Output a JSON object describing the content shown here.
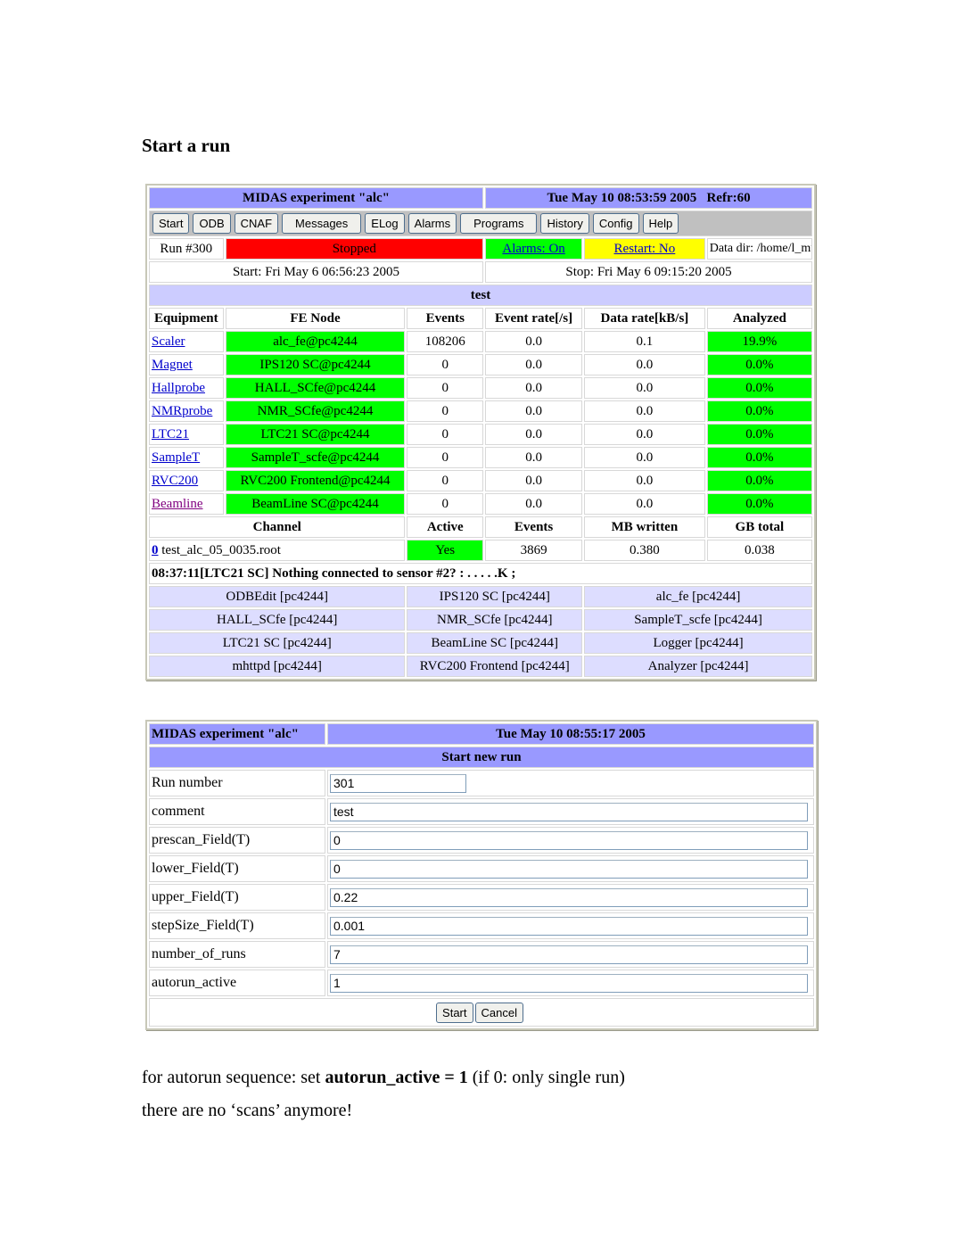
{
  "heading": "Start a run",
  "status_page": {
    "title": "MIDAS experiment \"alc\"",
    "datetime": "Tue May 10 08:53:59 2005   Refr:60",
    "buttons": [
      "Start",
      "ODB",
      "CNAF",
      "Messages",
      "ELog",
      "Alarms",
      "Programs",
      "History",
      "Config",
      "Help"
    ],
    "run_number": "Run #300",
    "run_state": "Stopped",
    "alarms": "Alarms: On",
    "restart": "Restart: No",
    "data_dir": "Data dir: /home/l_musr_alc/exp/alc/",
    "start_time": "Start: Fri May 6 06:56:23 2005",
    "stop_time": "Stop: Fri May 6 09:15:20 2005",
    "comment": "test",
    "equipment_headers": [
      "Equipment",
      "FE Node",
      "Events",
      "Event rate[/s]",
      "Data rate[kB/s]",
      "Analyzed"
    ],
    "equipment": [
      {
        "name": "Scaler",
        "node": "alc_fe@pc4244",
        "events": "108206",
        "event_rate": "0.0",
        "data_rate": "0.1",
        "analyzed": "19.9%"
      },
      {
        "name": "Magnet",
        "node": "IPS120 SC@pc4244",
        "events": "0",
        "event_rate": "0.0",
        "data_rate": "0.0",
        "analyzed": "0.0%"
      },
      {
        "name": "Hallprobe",
        "node": "HALL_SCfe@pc4244",
        "events": "0",
        "event_rate": "0.0",
        "data_rate": "0.0",
        "analyzed": "0.0%"
      },
      {
        "name": "NMRprobe",
        "node": "NMR_SCfe@pc4244",
        "events": "0",
        "event_rate": "0.0",
        "data_rate": "0.0",
        "analyzed": "0.0%"
      },
      {
        "name": "LTC21",
        "node": "LTC21 SC@pc4244",
        "events": "0",
        "event_rate": "0.0",
        "data_rate": "0.0",
        "analyzed": "0.0%"
      },
      {
        "name": "SampleT",
        "node": "SampleT_scfe@pc4244",
        "events": "0",
        "event_rate": "0.0",
        "data_rate": "0.0",
        "analyzed": "0.0%"
      },
      {
        "name": "RVC200",
        "node": "RVC200 Frontend@pc4244",
        "events": "0",
        "event_rate": "0.0",
        "data_rate": "0.0",
        "analyzed": "0.0%"
      },
      {
        "name": "Beamline",
        "node": "BeamLine SC@pc4244",
        "events": "0",
        "event_rate": "0.0",
        "data_rate": "0.0",
        "analyzed": "0.0%"
      }
    ],
    "channel_headers": [
      "Channel",
      "Active",
      "Events",
      "MB written",
      "GB total"
    ],
    "channel": {
      "index": "0",
      "file": " test_alc_05_0035.root",
      "active": "Yes",
      "events": "3869",
      "mb_written": "0.380",
      "gb_total": "0.038"
    },
    "message": "08:37:11[LTC21 SC] Nothing connected to sensor #2? : . . . . .K ;",
    "clients": [
      [
        "ODBEdit [pc4244]",
        "IPS120 SC [pc4244]",
        "alc_fe [pc4244]"
      ],
      [
        "HALL_SCfe [pc4244]",
        "NMR_SCfe [pc4244]",
        "SampleT_scfe [pc4244]"
      ],
      [
        "LTC21 SC [pc4244]",
        "BeamLine SC [pc4244]",
        "Logger [pc4244]"
      ],
      [
        "mhttpd [pc4244]",
        "RVC200 Frontend [pc4244]",
        "Analyzer [pc4244]"
      ]
    ]
  },
  "start_page": {
    "title": "MIDAS experiment \"alc\"",
    "datetime": "Tue May 10 08:55:17 2005",
    "subtitle": "Start new run",
    "fields": [
      {
        "label": "Run number",
        "value": "301"
      },
      {
        "label": "comment",
        "value": "test"
      },
      {
        "label": "prescan_Field(T)",
        "value": "0"
      },
      {
        "label": "lower_Field(T)",
        "value": "0"
      },
      {
        "label": "upper_Field(T)",
        "value": "0.22"
      },
      {
        "label": "stepSize_Field(T)",
        "value": "0.001"
      },
      {
        "label": "number_of_runs",
        "value": "7"
      },
      {
        "label": "autorun_active",
        "value": "1"
      }
    ],
    "start_button": "Start",
    "cancel_button": "Cancel"
  },
  "notes": {
    "line1_pre": "for autorun sequence: set ",
    "line1_bold": "autorun_active = 1",
    "line1_post": " (if 0: only single run)",
    "line2": "there are no ‘scans’ anymore!"
  }
}
